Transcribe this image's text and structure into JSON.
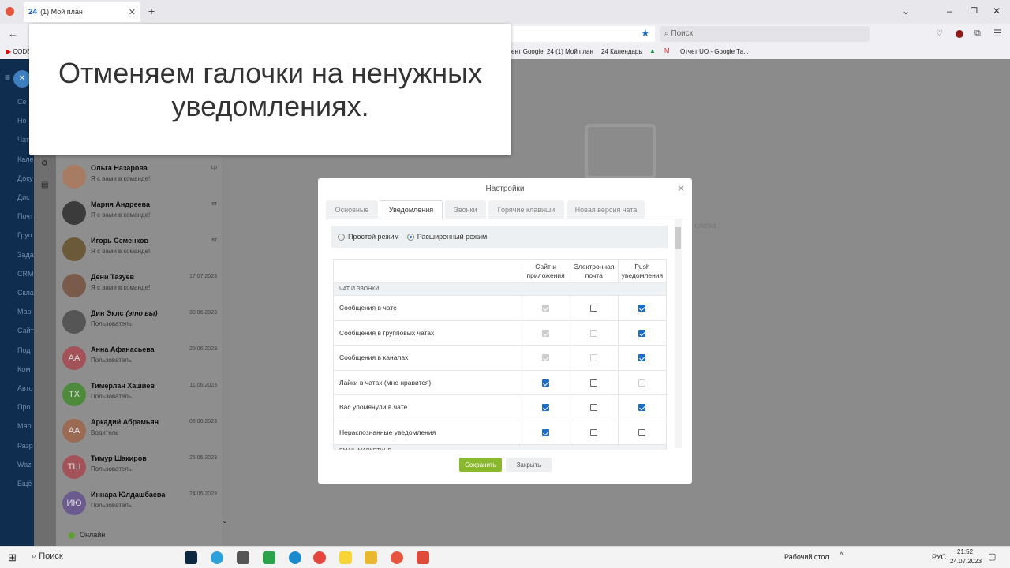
{
  "browser": {
    "tab_title": "(1) Мой план",
    "tab_icon": "24",
    "search_placeholder": "Поиск",
    "bookmarks": [
      "CODE",
      "ент Google",
      "24 (1) Мой план",
      "24 Календарь",
      "Отчет UO - Google Та..."
    ]
  },
  "sidebar": {
    "items": [
      "Се",
      "Но",
      "Чат",
      "Кале",
      "Доку",
      "Дис",
      "Почт",
      "Груп",
      "Зада",
      "CRM",
      "Скла",
      "Мар",
      "Сайт",
      "Под",
      "Ком",
      "Авто",
      "Про",
      "Мар",
      "Разр",
      "Waz",
      "Ещё"
    ]
  },
  "overlay": {
    "text": "Отменяем галочки на ненужных уведомлениях."
  },
  "chats": [
    {
      "name": "Ольга Назарова",
      "sub": "Я с вами в команде!",
      "date": "ср",
      "initials": "",
      "color": "#a77c63"
    },
    {
      "name": "Мария Андреева",
      "sub": "Я с вами в команде!",
      "date": "вт",
      "initials": "",
      "color": "#3b3b3b"
    },
    {
      "name": "Игорь Семенков",
      "sub": "Я с вами в команде!",
      "date": "вт",
      "initials": "",
      "color": "#6b5a3a"
    },
    {
      "name": "Дени Тазуев",
      "sub": "Я с вами в команде!",
      "date": "17.07.2023",
      "initials": "",
      "color": "#7a5a4a"
    },
    {
      "name": "Дин Эклс",
      "name_suffix": "(это вы)",
      "sub": "Пользователь",
      "date": "30.06.2023",
      "initials": "",
      "color": "#555"
    },
    {
      "name": "Анна Афанасьева",
      "sub": "Пользователь",
      "date": "29.06.2023",
      "initials": "АА",
      "color": "#a4525a"
    },
    {
      "name": "Тимерлан Хашиев",
      "sub": "Пользователь",
      "date": "11.06.2023",
      "initials": "ТХ",
      "color": "#4e8a3b"
    },
    {
      "name": "Аркадий Абрамьян",
      "sub": "Водитель",
      "date": "08.06.2023",
      "initials": "АА",
      "color": "#9a6a52"
    },
    {
      "name": "Тимур Шакиров",
      "sub": "Пользователь",
      "date": "25.05.2023",
      "initials": "ТШ",
      "color": "#a4525a"
    },
    {
      "name": "Иннара Юлдашбаева",
      "sub": "Пользователь",
      "date": "24.05.2023",
      "initials": "ИЮ",
      "color": "#6a5a8e"
    }
  ],
  "status": {
    "online": "Онлайн"
  },
  "main": {
    "empty_hint": "а слева."
  },
  "dialog": {
    "title": "Настройки",
    "tabs": [
      "Основные",
      "Уведомления",
      "Звонки",
      "Горячие клавиши",
      "Новая версия чата"
    ],
    "active_tab": 1,
    "modes": {
      "simple": "Простой режим",
      "extended": "Расширенный режим",
      "selected": "extended"
    },
    "columns": [
      "Сайт и приложения",
      "Электронная почта",
      "Push уведомления"
    ],
    "section": "ЧАТ И ЗВОНКИ",
    "next_section": "EMAIL-МАРКЕТИНГ",
    "rows": [
      {
        "label": "Сообщения в чате",
        "site": "disabled-on",
        "email": "off",
        "push": "on"
      },
      {
        "label": "Сообщения в групповых чатах",
        "site": "disabled-on",
        "email": "disabled-off",
        "push": "on"
      },
      {
        "label": "Сообщения в каналах",
        "site": "disabled-on",
        "email": "disabled-off",
        "push": "on"
      },
      {
        "label": "Лайки в чатах (мне нравится)",
        "site": "on",
        "email": "off",
        "push": "disabled-off"
      },
      {
        "label": "Вас упомянули в чате",
        "site": "on",
        "email": "off",
        "push": "on"
      },
      {
        "label": "Нераспознанные уведомления",
        "site": "on",
        "email": "off",
        "push": "off"
      }
    ],
    "save_label": "Сохранить",
    "close_label": "Закрыть"
  },
  "taskbar": {
    "search": "Поиск",
    "desktop": "Рабочий стол",
    "lang": "РУС",
    "time": "21:52",
    "date": "24.07.2023"
  },
  "colors": {
    "accent": "#1c6ec7",
    "save": "#8ab92d",
    "sidebar": "#0f2d4f"
  }
}
